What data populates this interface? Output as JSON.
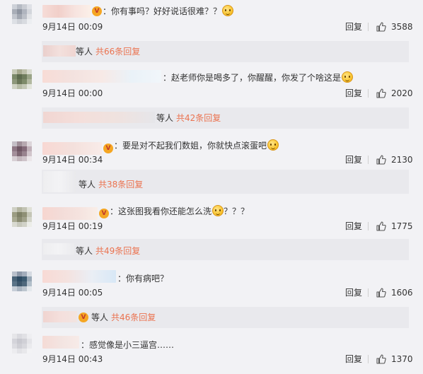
{
  "comments": [
    {
      "text": "：你有事吗？好好说话很难？？",
      "time": "9月14日 00:09",
      "reply_label": "回复",
      "likes": "3588",
      "replies": {
        "who": "等人",
        "count": "共66条回复"
      }
    },
    {
      "text": "：赵老师你是喝多了，你醒醒，你发了个啥这是",
      "time": "9月14日 00:00",
      "reply_label": "回复",
      "likes": "2020",
      "replies": {
        "who": "等人",
        "count": "共42条回复"
      }
    },
    {
      "text": "：要是对不起我们数姐，你就快点滚蛋吧",
      "time": "9月14日 00:34",
      "reply_label": "回复",
      "likes": "2130",
      "replies": {
        "who": "等人",
        "count": "共38条回复"
      }
    },
    {
      "text": "：这张图我看你还能怎么洗",
      "text_after": "？？？",
      "time": "9月14日 00:19",
      "reply_label": "回复",
      "likes": "1775",
      "replies": {
        "who": "等人",
        "count": "共49条回复"
      }
    },
    {
      "text": "：你有病吧？",
      "time": "9月14日 00:05",
      "reply_label": "回复",
      "likes": "1606",
      "replies": {
        "who": "等人",
        "count": "共46条回复"
      }
    },
    {
      "text": "：感觉像是小三逼宫……",
      "time": "9月14日 00:43",
      "reply_label": "回复",
      "likes": "1370"
    }
  ],
  "colors": {
    "background": "#f2f2f5",
    "reply_box": "#e9e9ed",
    "reply_count_accent": "#eb7350",
    "name_blur": "#f4d6d2"
  },
  "icons": [
    "thumbs-up-icon",
    "smiley-emoji-icon",
    "vip-badge-icon"
  ]
}
